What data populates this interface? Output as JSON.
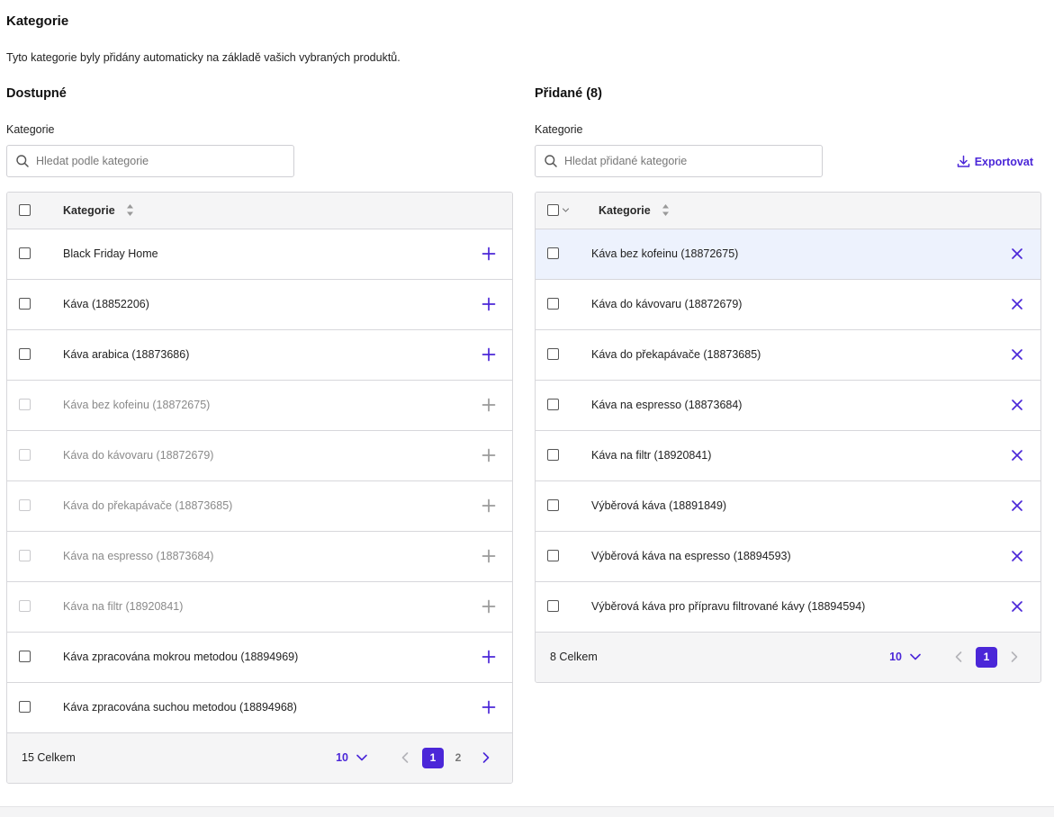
{
  "page": {
    "title": "Kategorie",
    "description": "Tyto kategorie byly přidány automaticky na základě vašich vybraných produktů."
  },
  "available": {
    "title": "Dostupné",
    "field_label": "Kategorie",
    "search_placeholder": "Hledat podle kategorie",
    "column_header": "Kategorie",
    "rows": [
      {
        "label": "Black Friday Home",
        "disabled": false
      },
      {
        "label": "Káva (18852206)",
        "disabled": false
      },
      {
        "label": "Káva arabica (18873686)",
        "disabled": false
      },
      {
        "label": "Káva bez kofeinu (18872675)",
        "disabled": true
      },
      {
        "label": "Káva do kávovaru (18872679)",
        "disabled": true
      },
      {
        "label": "Káva do překapávače (18873685)",
        "disabled": true
      },
      {
        "label": "Káva na espresso (18873684)",
        "disabled": true
      },
      {
        "label": "Káva na filtr (18920841)",
        "disabled": true
      },
      {
        "label": "Káva zpracována mokrou metodou (18894969)",
        "disabled": false
      },
      {
        "label": "Káva zpracována suchou metodou (18894968)",
        "disabled": false
      }
    ],
    "total": "15 Celkem",
    "per_page": "10",
    "pages": [
      "1",
      "2"
    ],
    "current_page": "1"
  },
  "added": {
    "title": "Přidané (8)",
    "field_label": "Kategorie",
    "search_placeholder": "Hledat přidané kategorie",
    "export_label": "Exportovat",
    "column_header": "Kategorie",
    "rows": [
      {
        "label": "Káva bez kofeinu (18872675)",
        "highlighted": true
      },
      {
        "label": "Káva do kávovaru (18872679)",
        "highlighted": false
      },
      {
        "label": "Káva do překapávače (18873685)",
        "highlighted": false
      },
      {
        "label": "Káva na espresso (18873684)",
        "highlighted": false
      },
      {
        "label": "Káva na filtr (18920841)",
        "highlighted": false
      },
      {
        "label": "Výběrová káva (18891849)",
        "highlighted": false
      },
      {
        "label": "Výběrová káva na espresso (18894593)",
        "highlighted": false
      },
      {
        "label": "Výběrová káva pro přípravu filtrované kávy (18894594)",
        "highlighted": false
      }
    ],
    "total": "8 Celkem",
    "per_page": "10",
    "pages": [
      "1"
    ],
    "current_page": "1"
  },
  "icons": {
    "search": "search-icon",
    "add": "plus-icon",
    "remove": "close-icon",
    "export": "download-icon",
    "sort": "sort-icon",
    "dropdown": "chevron-down-icon",
    "prev": "chevron-left-icon",
    "next": "chevron-right-icon"
  },
  "colors": {
    "accent": "#4b27d8",
    "disabled_icon": "#9a9a9a",
    "selected_row": "#edf2fd",
    "header_bg": "#f5f5f6"
  }
}
